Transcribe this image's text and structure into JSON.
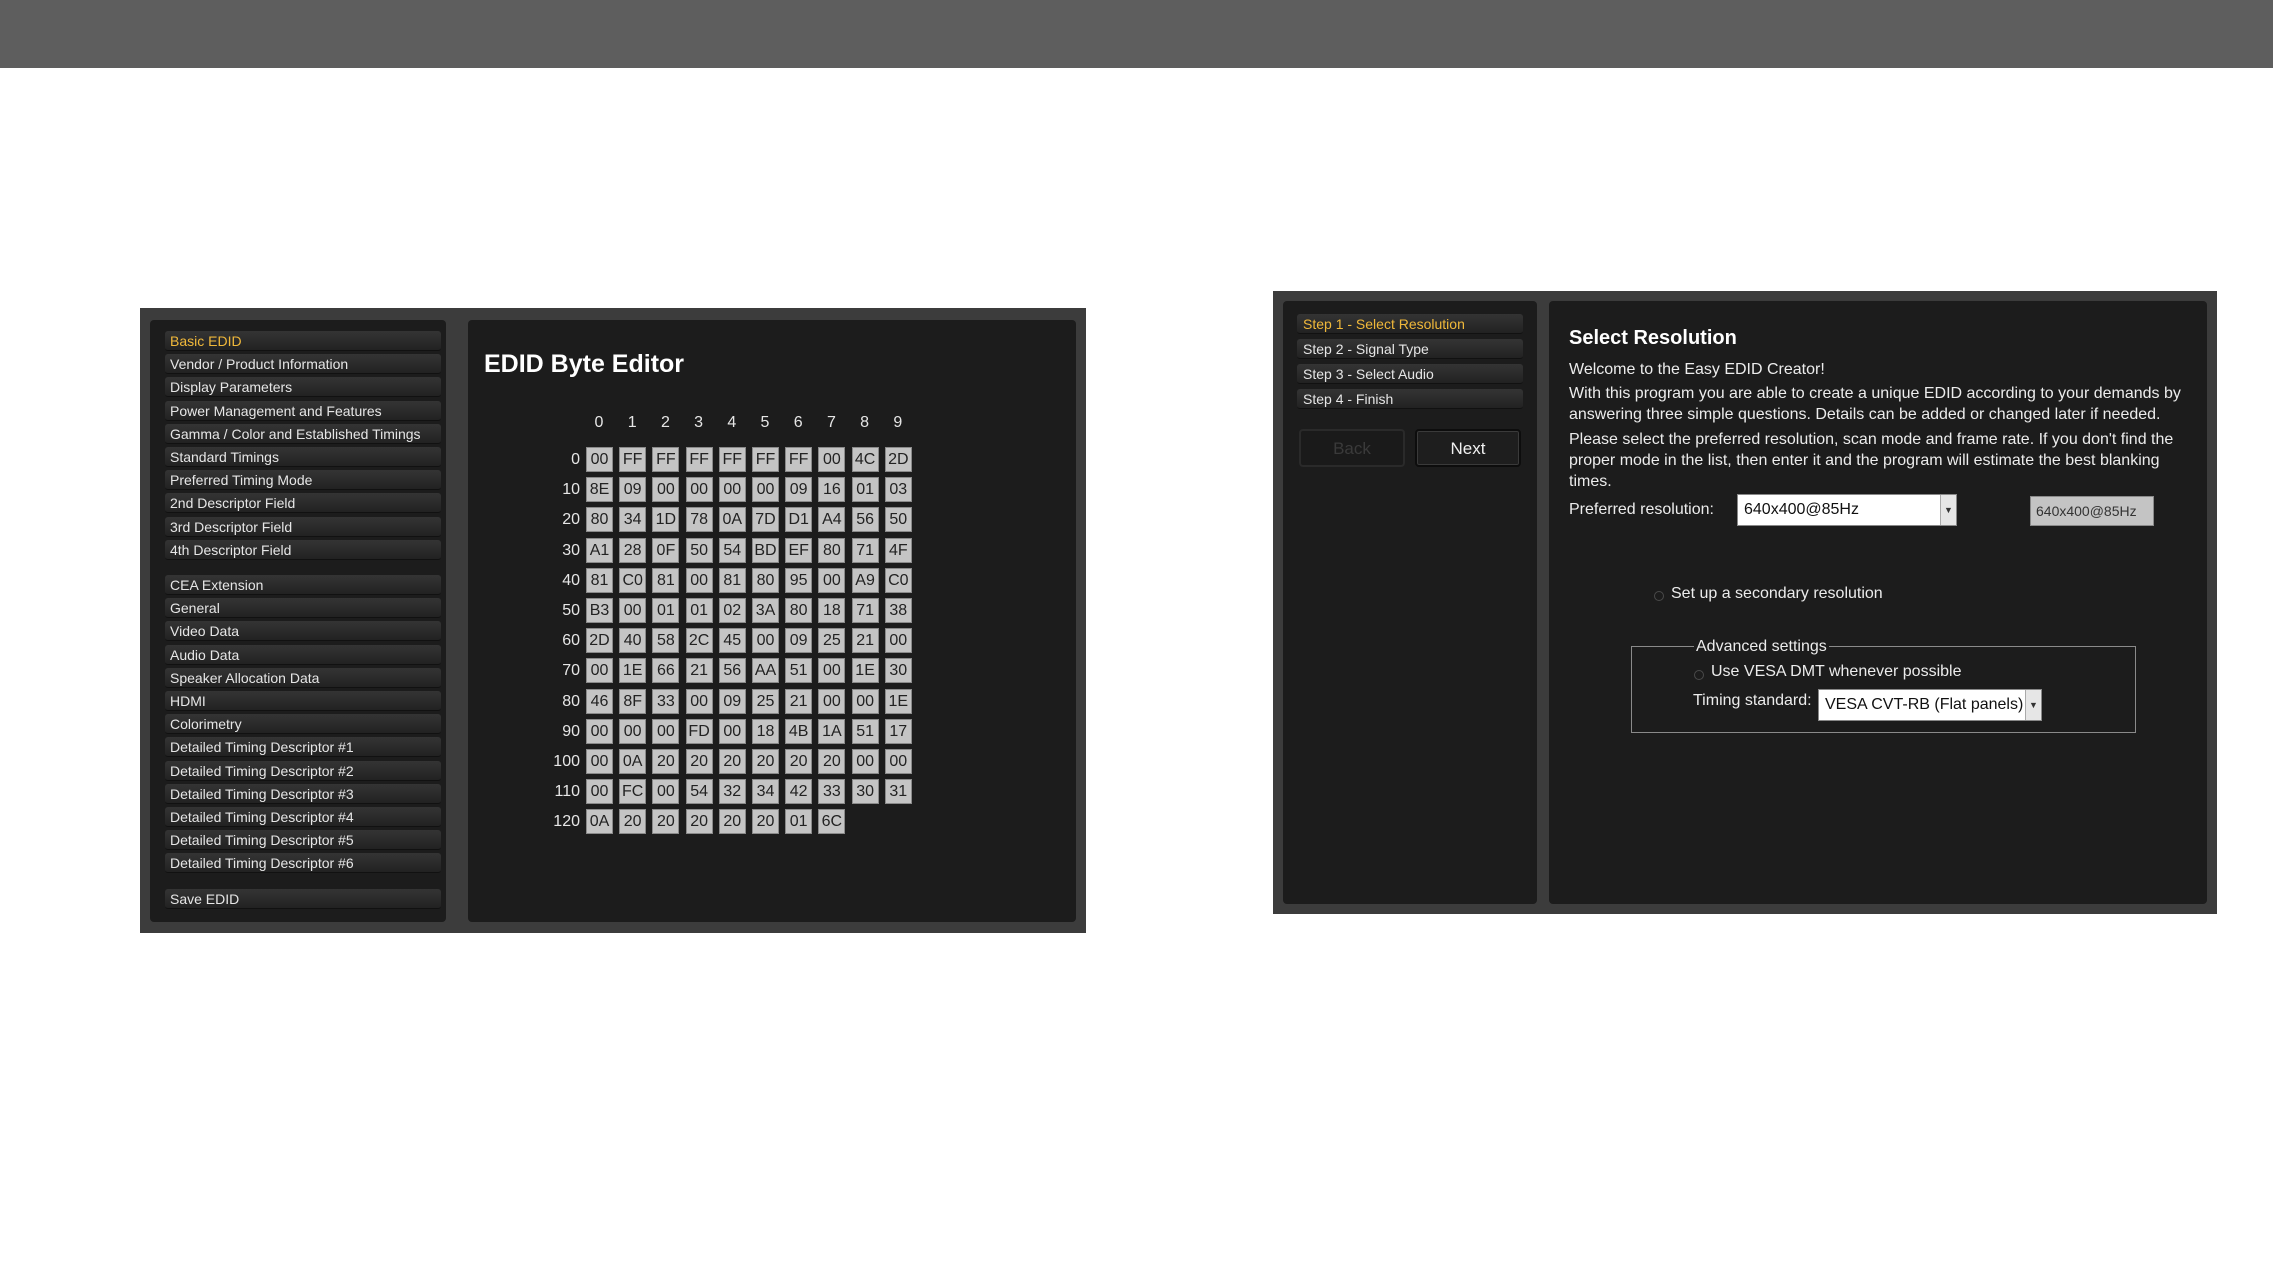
{
  "left_panel": {
    "nav_items": [
      "Basic EDID",
      "Vendor / Product Information",
      "Display Parameters",
      "Power Management and Features",
      "Gamma / Color and Established Timings",
      "Standard Timings",
      "Preferred Timing Mode",
      "2nd Descriptor Field",
      "3rd Descriptor Field",
      "4th Descriptor Field",
      "CEA Extension",
      "General",
      "Video Data",
      "Audio Data",
      "Speaker Allocation Data",
      "HDMI",
      "Colorimetry",
      "Detailed Timing Descriptor #1",
      "Detailed Timing Descriptor #2",
      "Detailed Timing Descriptor #3",
      "Detailed Timing Descriptor #4",
      "Detailed Timing Descriptor #5",
      "Detailed Timing Descriptor #6",
      "Save EDID"
    ],
    "active_item": "Basic EDID",
    "editor_title": "EDID Byte Editor",
    "column_headers": [
      "0",
      "1",
      "2",
      "3",
      "4",
      "5",
      "6",
      "7",
      "8",
      "9"
    ],
    "row_headers": [
      "0",
      "10",
      "20",
      "30",
      "40",
      "50",
      "60",
      "70",
      "80",
      "90",
      "100",
      "110",
      "120"
    ],
    "bytes": [
      [
        "00",
        "FF",
        "FF",
        "FF",
        "FF",
        "FF",
        "FF",
        "00",
        "4C",
        "2D"
      ],
      [
        "8E",
        "09",
        "00",
        "00",
        "00",
        "00",
        "09",
        "16",
        "01",
        "03"
      ],
      [
        "80",
        "34",
        "1D",
        "78",
        "0A",
        "7D",
        "D1",
        "A4",
        "56",
        "50"
      ],
      [
        "A1",
        "28",
        "0F",
        "50",
        "54",
        "BD",
        "EF",
        "80",
        "71",
        "4F"
      ],
      [
        "81",
        "C0",
        "81",
        "00",
        "81",
        "80",
        "95",
        "00",
        "A9",
        "C0"
      ],
      [
        "B3",
        "00",
        "01",
        "01",
        "02",
        "3A",
        "80",
        "18",
        "71",
        "38"
      ],
      [
        "2D",
        "40",
        "58",
        "2C",
        "45",
        "00",
        "09",
        "25",
        "21",
        "00"
      ],
      [
        "00",
        "1E",
        "66",
        "21",
        "56",
        "AA",
        "51",
        "00",
        "1E",
        "30"
      ],
      [
        "46",
        "8F",
        "33",
        "00",
        "09",
        "25",
        "21",
        "00",
        "00",
        "1E"
      ],
      [
        "00",
        "00",
        "00",
        "FD",
        "00",
        "18",
        "4B",
        "1A",
        "51",
        "17"
      ],
      [
        "00",
        "0A",
        "20",
        "20",
        "20",
        "20",
        "20",
        "20",
        "00",
        "00"
      ],
      [
        "00",
        "FC",
        "00",
        "54",
        "32",
        "34",
        "42",
        "33",
        "30",
        "31"
      ],
      [
        "0A",
        "20",
        "20",
        "20",
        "20",
        "20",
        "01",
        "6C"
      ]
    ]
  },
  "right_panel": {
    "steps": [
      "Step 1 - Select Resolution",
      "Step 2 - Signal Type",
      "Step 3 - Select Audio",
      "Step 4 - Finish"
    ],
    "active_step": "Step 1 - Select Resolution",
    "back_label": "Back",
    "next_label": "Next",
    "title": "Select Resolution",
    "welcome": "Welcome to the Easy EDID Creator!",
    "paragraph1": "With this program you are able to create a unique EDID according to your demands by answering three simple questions. Details can be added or changed later if needed.",
    "paragraph2": "Please select the preferred resolution, scan mode and frame rate. If you don't find the proper mode in the list, then enter it and the program will estimate the best blanking times.",
    "preferred_label": "Preferred resolution:",
    "preferred_value": "640x400@85Hz",
    "preferred_field": "640x400@85Hz",
    "secondary_label": "Set up a secondary resolution",
    "advanced_legend": "Advanced settings",
    "vesa_label": "Use VESA DMT whenever possible",
    "timing_label": "Timing standard:",
    "timing_value": "VESA CVT-RB (Flat panels)"
  },
  "colors": {
    "accent": "#f0b83a",
    "panel_bg": "#1c1c1c",
    "frame_bg": "#3c3c3c",
    "topbar": "#5e5e5e"
  }
}
